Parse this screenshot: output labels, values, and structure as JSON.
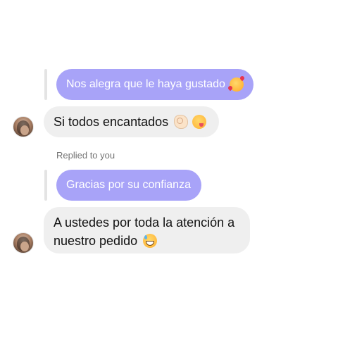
{
  "thread": {
    "reply_1": {
      "text": "Nos alegra que le haya gustado",
      "emoji": "smiling-face-with-hearts-icon"
    },
    "message_1": {
      "text": "Si todos encantados",
      "emojis": [
        "ok-hand-icon",
        "face-savoring-food-icon"
      ]
    },
    "replied_label": "Replied to you",
    "reply_2": {
      "text": "Gracias por su confianza"
    },
    "message_2": {
      "line_1": "A ustedes por toda la atención a",
      "line_2": "nuestro pedido",
      "emoji": "grinning-face-with-sweat-icon"
    }
  },
  "colors": {
    "reply_bubble": "#a8a3f8",
    "message_bubble": "#efefef",
    "reply_bar": "#e4e4e4",
    "label": "#737373"
  }
}
